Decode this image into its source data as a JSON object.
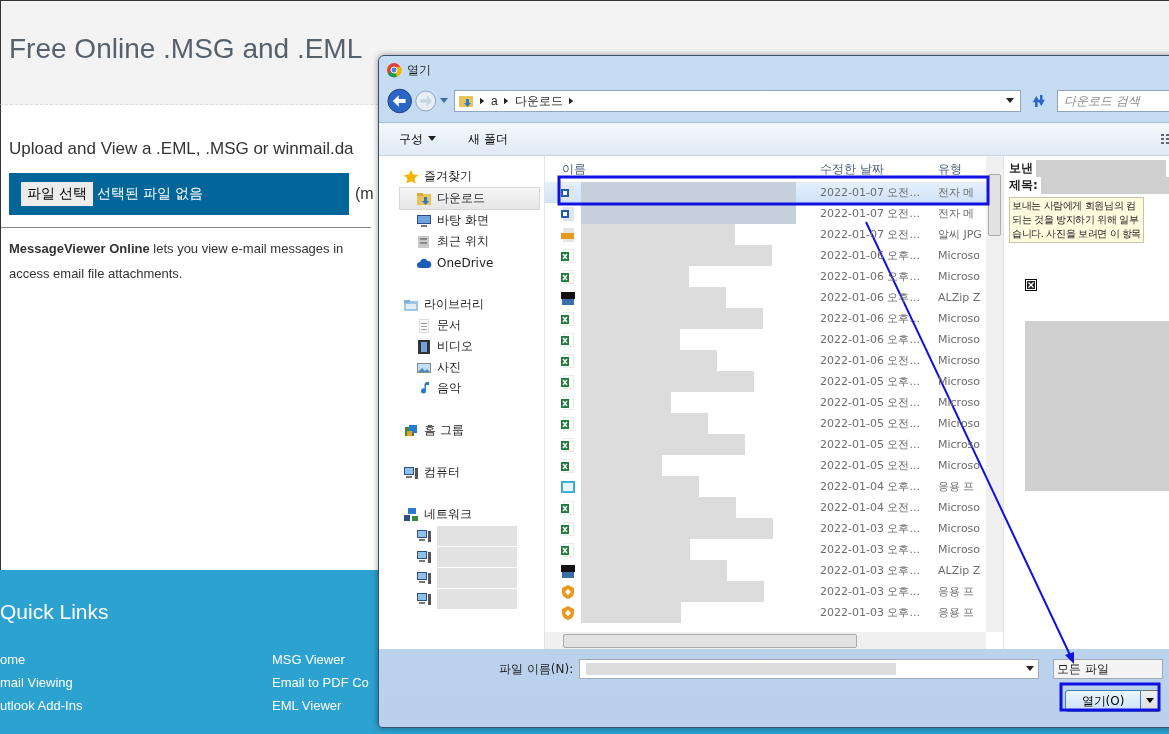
{
  "page": {
    "title": "Free Online .MSG and .EML",
    "upload_prompt": "Upload and View a .EML, .MSG or winmail.da",
    "file_button": "파일 선택",
    "file_status": "선택된 파일 없음",
    "size_note": "(m",
    "description": [
      "**MessageViewer Online** lets you view e-mail messages in",
      "access email file attachments."
    ],
    "quick_links": {
      "title": "Quick Links",
      "columns": [
        [
          "ome",
          "mail Viewing",
          "utlook Add-Ins"
        ],
        [
          "MSG Viewer",
          "Email to PDF Co",
          "EML Viewer"
        ]
      ]
    }
  },
  "dialog": {
    "title": "열기",
    "path": [
      "a",
      "다운로드"
    ],
    "search_placeholder": "다운로드 검색",
    "toolbar": [
      {
        "label": "구성",
        "menu": true
      },
      {
        "label": "새 폴더",
        "menu": false
      }
    ],
    "nav": [
      {
        "label": "즐겨찾기",
        "kind": "star",
        "selected": false,
        "children": [
          {
            "label": "다운로드",
            "kind": "download",
            "selected": true
          },
          {
            "label": "바탕 화면",
            "kind": "desktop",
            "selected": false
          },
          {
            "label": "최근 위치",
            "kind": "recent",
            "selected": false
          },
          {
            "label": "OneDrive",
            "kind": "cloud",
            "selected": false
          }
        ]
      },
      {
        "label": "라이브러리",
        "kind": "library",
        "selected": false,
        "children": [
          {
            "label": "문서",
            "kind": "document",
            "selected": false
          },
          {
            "label": "비디오",
            "kind": "video",
            "selected": false
          },
          {
            "label": "사진",
            "kind": "photo",
            "selected": false
          },
          {
            "label": "음악",
            "kind": "music",
            "selected": false
          }
        ]
      },
      {
        "label": "홈 그룹",
        "kind": "homegroup",
        "selected": false
      },
      {
        "label": "컴퓨터",
        "kind": "computer",
        "selected": false
      },
      {
        "label": "네트워크",
        "kind": "network",
        "selected": false,
        "children": [
          {
            "kind": "computer",
            "selected": false
          },
          {
            "kind": "computer",
            "selected": false
          },
          {
            "kind": "computer",
            "selected": false
          },
          {
            "kind": "computer",
            "selected": false
          }
        ]
      }
    ],
    "columns": [
      "이름",
      "수정한 날짜",
      "유형"
    ],
    "rows": [
      {
        "kind": "mail",
        "date": "2022-01-07 오전...",
        "type": "전자 메",
        "selected": true
      },
      {
        "kind": "mail",
        "date": "2022-01-07 오전...",
        "type": "전자 메",
        "selected": false
      },
      {
        "kind": "image",
        "date": "2022-01-07 오전...",
        "type": "알씨 JPG",
        "selected": false
      },
      {
        "kind": "sheet",
        "date": "2022-01-06 오후...",
        "type": "Microso",
        "selected": false
      },
      {
        "kind": "sheet",
        "date": "2022-01-06 오후...",
        "type": "Microso",
        "selected": false
      },
      {
        "kind": "zip",
        "date": "2022-01-06 오후...",
        "type": "ALZip Z",
        "selected": false
      },
      {
        "kind": "sheet",
        "date": "2022-01-06 오후...",
        "type": "Microso",
        "selected": false
      },
      {
        "kind": "sheet",
        "date": "2022-01-06 오후...",
        "type": "Microso",
        "selected": false
      },
      {
        "kind": "sheet",
        "date": "2022-01-06 오전...",
        "type": "Microso",
        "selected": false
      },
      {
        "kind": "sheet",
        "date": "2022-01-05 오후...",
        "type": "Microso",
        "selected": false
      },
      {
        "kind": "sheet",
        "date": "2022-01-05 오전...",
        "type": "Microso",
        "selected": false
      },
      {
        "kind": "sheet",
        "date": "2022-01-05 오전...",
        "type": "Microso",
        "selected": false
      },
      {
        "kind": "sheet",
        "date": "2022-01-05 오전...",
        "type": "Microso",
        "selected": false
      },
      {
        "kind": "sheet",
        "date": "2022-01-05 오전...",
        "type": "Microso",
        "selected": false
      },
      {
        "kind": "app",
        "date": "2022-01-04 오후...",
        "type": "응용 프",
        "selected": false
      },
      {
        "kind": "sheet",
        "date": "2022-01-04 오전...",
        "type": "Microso",
        "selected": false
      },
      {
        "kind": "sheet",
        "date": "2022-01-03 오후...",
        "type": "Microso",
        "selected": false
      },
      {
        "kind": "sheet",
        "date": "2022-01-03 오후...",
        "type": "Microso",
        "selected": false
      },
      {
        "kind": "zip",
        "date": "2022-01-03 오후...",
        "type": "ALZip Z",
        "selected": false
      },
      {
        "kind": "shield",
        "date": "2022-01-03 오후...",
        "type": "응용 프",
        "selected": false
      },
      {
        "kind": "shield",
        "date": "2022-01-03 오후...",
        "type": "응용 프",
        "selected": false
      }
    ],
    "preview": {
      "from_label": "보낸",
      "subject_label": "제목:",
      "notice": [
        "보내는 사람에게 회원님의 컴",
        "되는 것을 방지하기 위해 일부",
        "습니다. 사진을 보려면 이 항목"
      ]
    },
    "filename_label": "파일 이름(N):",
    "filetype": "모든 파일",
    "open_button": "열기(O)"
  }
}
